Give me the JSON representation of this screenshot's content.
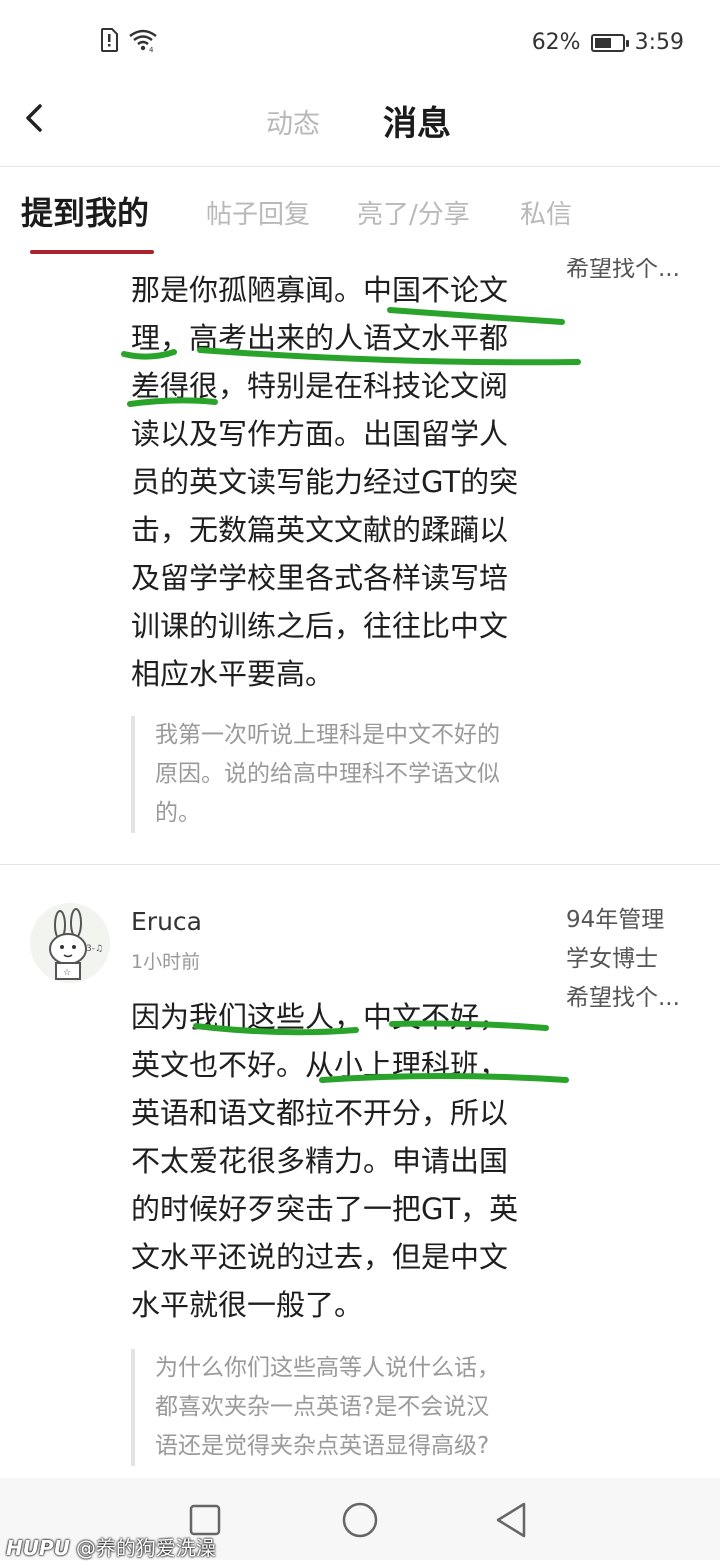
{
  "status_bar": {
    "battery_percent": "62%",
    "battery_level": 0.62,
    "time": "3:59",
    "icons": [
      "sim-icon",
      "wifi-icon",
      "battery-icon"
    ]
  },
  "header": {
    "tabs": [
      {
        "label": "动态",
        "active": false
      },
      {
        "label": "消息",
        "active": true
      }
    ]
  },
  "subtabs": [
    {
      "label": "提到我的",
      "active": true
    },
    {
      "label": "帖子回复",
      "active": false
    },
    {
      "label": "亮了/分享",
      "active": false
    },
    {
      "label": "私信",
      "active": false
    }
  ],
  "posts": [
    {
      "side_lines": [
        "希望找个..."
      ],
      "body_lines": [
        "那是你孤陋寡闻。中国不论文",
        "理，高考出来的人语文水平都",
        "差得很，特别是在科技论文阅",
        "读以及写作方面。出国留学人",
        "员的英文读写能力经过GT的突",
        "击，无数篇英文文献的蹂躏以",
        "及留学学校里各式各样读写培",
        "训课的训练之后，往往比中文",
        "相应水平要高。"
      ],
      "quote_lines": [
        "我第一次听说上理科是中文不好的",
        "原因。说的给高中理科不学语文似",
        "的。"
      ]
    },
    {
      "username": "Eruca",
      "timestamp": "1小时前",
      "side_lines": [
        "94年管理",
        "学女博士",
        "希望找个..."
      ],
      "body_lines": [
        "因为我们这些人，中文不好，",
        "英文也不好。从小上理科班，",
        "英语和语文都拉不开分，所以",
        "不太爱花很多精力。申请出国",
        "的时候好歹突击了一把GT，英",
        "文水平还说的过去，但是中文",
        "水平就很一般了。"
      ],
      "quote_lines": [
        "为什么你们这些高等人说什么话，",
        "都喜欢夹杂一点英语?是不会说汉",
        "语还是觉得夹杂点英语显得高级?"
      ]
    }
  ],
  "watermark": {
    "brand": "HUPU",
    "text": "@养的狗爱洗澡"
  },
  "colors": {
    "accent": "#a8252c",
    "annotation": "#2aa32a",
    "inactive_text": "#b9b9b9"
  }
}
